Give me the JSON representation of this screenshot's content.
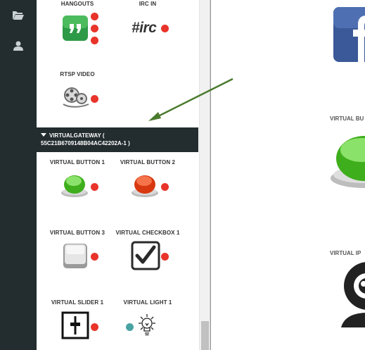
{
  "colors": {
    "rail_bg": "#232c2f",
    "status_dot": "#e8342a",
    "status_dot_alt": "#4aa3a3",
    "arrow": "#4a7a2e"
  },
  "rail": {
    "icons": [
      "folder-open-icon",
      "user-icon"
    ]
  },
  "widgets": {
    "hangouts": "HANGOUTS",
    "irc_in": "IRC IN",
    "irc_glyph": "#irc",
    "rtsp_video": "RTSP VIDEO",
    "virtual_button_1": "VIRTUAL BUTTON 1",
    "virtual_button_2": "VIRTUAL BUTTON 2",
    "virtual_button_3": "VIRTUAL BUTTON 3",
    "virtual_checkbox_1": "VIRTUAL CHECKBOX 1",
    "virtual_slider_1": "VIRTUAL SLIDER 1",
    "virtual_light_1": "VIRTUAL LIGHT 1"
  },
  "gateway": {
    "name": "VIRTUALGATEWAY (",
    "id": "55C21B6709148B04AC42202A-1 )"
  },
  "canvas": {
    "label_1": "VIRTUAL BU",
    "label_2": "VIRTUAL IP"
  }
}
